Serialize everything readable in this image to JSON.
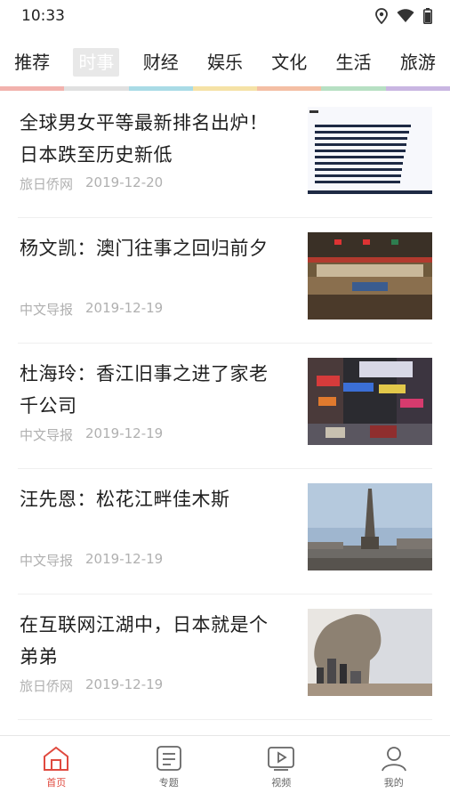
{
  "status_bar": {
    "time": "10:33"
  },
  "tabs": [
    {
      "label": "推荐"
    },
    {
      "label": "时事",
      "active": true
    },
    {
      "label": "财经"
    },
    {
      "label": "娱乐"
    },
    {
      "label": "文化"
    },
    {
      "label": "生活"
    },
    {
      "label": "旅游"
    }
  ],
  "tab_colors": [
    "#f2b2ad",
    "#e0e0e0",
    "#a9dbe6",
    "#f5e2a6",
    "#f4bfa4",
    "#b7e0c3",
    "#c9b6e2"
  ],
  "news": [
    {
      "title": "全球男女平等最新排名出炉！日本跌至历史新低",
      "source": "旅日侨网",
      "date": "2019-12-20",
      "thumb": "chart-icon"
    },
    {
      "title": "杨文凯：澳门往事之回归前夕",
      "source": "中文导报",
      "date": "2019-12-19",
      "thumb": "ceremony-photo"
    },
    {
      "title": "杜海玲：香江旧事之进了家老千公司",
      "source": "中文导报",
      "date": "2019-12-19",
      "thumb": "street-photo"
    },
    {
      "title": "汪先恩：松花江畔佳木斯",
      "source": "中文导报",
      "date": "2019-12-19",
      "thumb": "monument-photo"
    },
    {
      "title": "在互联网江湖中，日本就是个弟弟",
      "source": "旅日侨网",
      "date": "2019-12-19",
      "thumb": "city-silhouette-photo"
    }
  ],
  "bottom_nav": [
    {
      "label": "首页",
      "icon": "home-icon",
      "active": true
    },
    {
      "label": "专题",
      "icon": "topic-icon"
    },
    {
      "label": "视频",
      "icon": "video-icon"
    },
    {
      "label": "我的",
      "icon": "profile-icon"
    }
  ],
  "colors": {
    "accent": "#e04a3f"
  }
}
